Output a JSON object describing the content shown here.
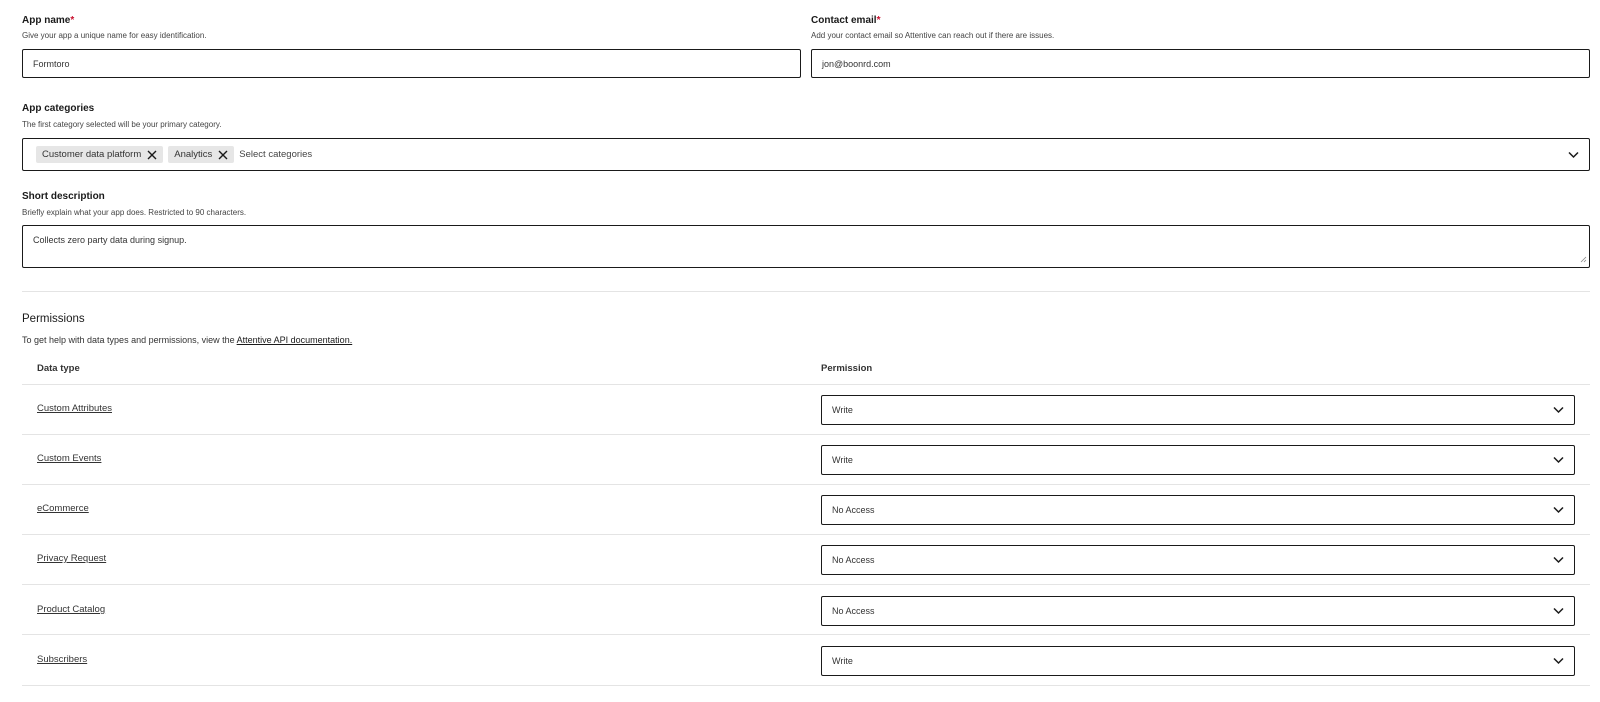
{
  "app_name": {
    "label": "App name",
    "required_mark": "*",
    "help": "Give your app a unique name for easy identification.",
    "value": "Formtoro"
  },
  "contact_email": {
    "label": "Contact email",
    "required_mark": "*",
    "help": "Add your contact email so Attentive can reach out if there are issues.",
    "value": "jon@boonrd.com"
  },
  "app_categories": {
    "label": "App categories",
    "help": "The first category selected will be your primary category.",
    "chips": [
      "Customer data platform",
      "Analytics"
    ],
    "placeholder": "Select categories"
  },
  "short_description": {
    "label": "Short description",
    "help": "Briefly explain what your app does. Restricted to 90 characters.",
    "value": "Collects zero party data during signup."
  },
  "permissions": {
    "title": "Permissions",
    "intro_text": "To get help with data types and permissions, view the ",
    "intro_link": "Attentive API documentation.",
    "col_data_type": "Data type",
    "col_permission": "Permission",
    "rows": [
      {
        "data_type": "Custom Attributes",
        "permission": "Write"
      },
      {
        "data_type": "Custom Events",
        "permission": "Write"
      },
      {
        "data_type": "eCommerce",
        "permission": "No Access"
      },
      {
        "data_type": "Privacy Request",
        "permission": "No Access"
      },
      {
        "data_type": "Product Catalog",
        "permission": "No Access"
      },
      {
        "data_type": "Subscribers",
        "permission": "Write"
      }
    ]
  },
  "colors": {
    "required": "#c8102e",
    "border": "#1a1a1a",
    "chip_bg": "#e6e6e6",
    "divider": "#e4e4e4"
  },
  "icons": {
    "chip_remove": "close-icon",
    "dropdown": "chevron-down-icon",
    "resize": "resize-handle-icon"
  }
}
